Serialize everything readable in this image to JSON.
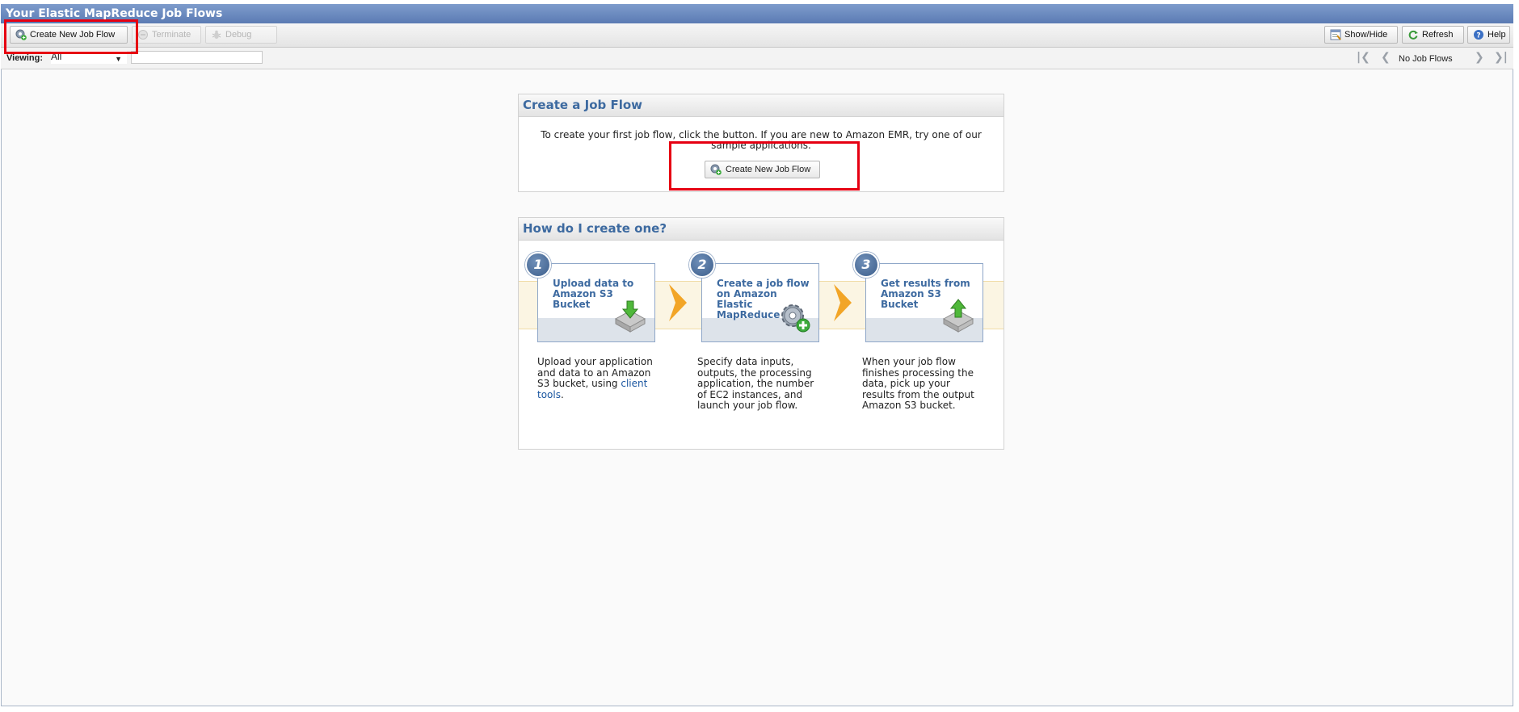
{
  "window": {
    "title": "Your Elastic MapReduce Job Flows"
  },
  "toolbar": {
    "create_label": "Create New Job Flow",
    "terminate_label": "Terminate",
    "debug_label": "Debug",
    "showhide_label": "Show/Hide",
    "refresh_label": "Refresh",
    "help_label": "Help"
  },
  "filter": {
    "viewing_label": "Viewing:",
    "viewing_value": "All",
    "search_value": ""
  },
  "pager": {
    "status": "No Job Flows"
  },
  "create_panel": {
    "title": "Create a Job Flow",
    "text": "To create your first job flow, click the button. If you are new to Amazon EMR, try one of our sample applications.",
    "button_label": "Create New Job Flow"
  },
  "howto_panel": {
    "title": "How do I create one?",
    "steps": [
      {
        "number": "1",
        "title": "Upload data to Amazon S3 Bucket",
        "desc_before": "Upload your application and data to an Amazon S3 bucket, using ",
        "link": "client tools",
        "desc_after": "."
      },
      {
        "number": "2",
        "title": "Create a job flow on Amazon Elastic MapReduce",
        "desc": "Specify data inputs, outputs, the processing application, the number of EC2 instances, and launch your job flow."
      },
      {
        "number": "3",
        "title": "Get results from Amazon S3 Bucket",
        "desc": "When your job flow finishes processing the data, pick up your results from the output Amazon S3 bucket."
      }
    ]
  },
  "colors": {
    "accent": "#3d6aa0",
    "highlight": "#e60012",
    "titlebar": "#5b7bb3"
  }
}
